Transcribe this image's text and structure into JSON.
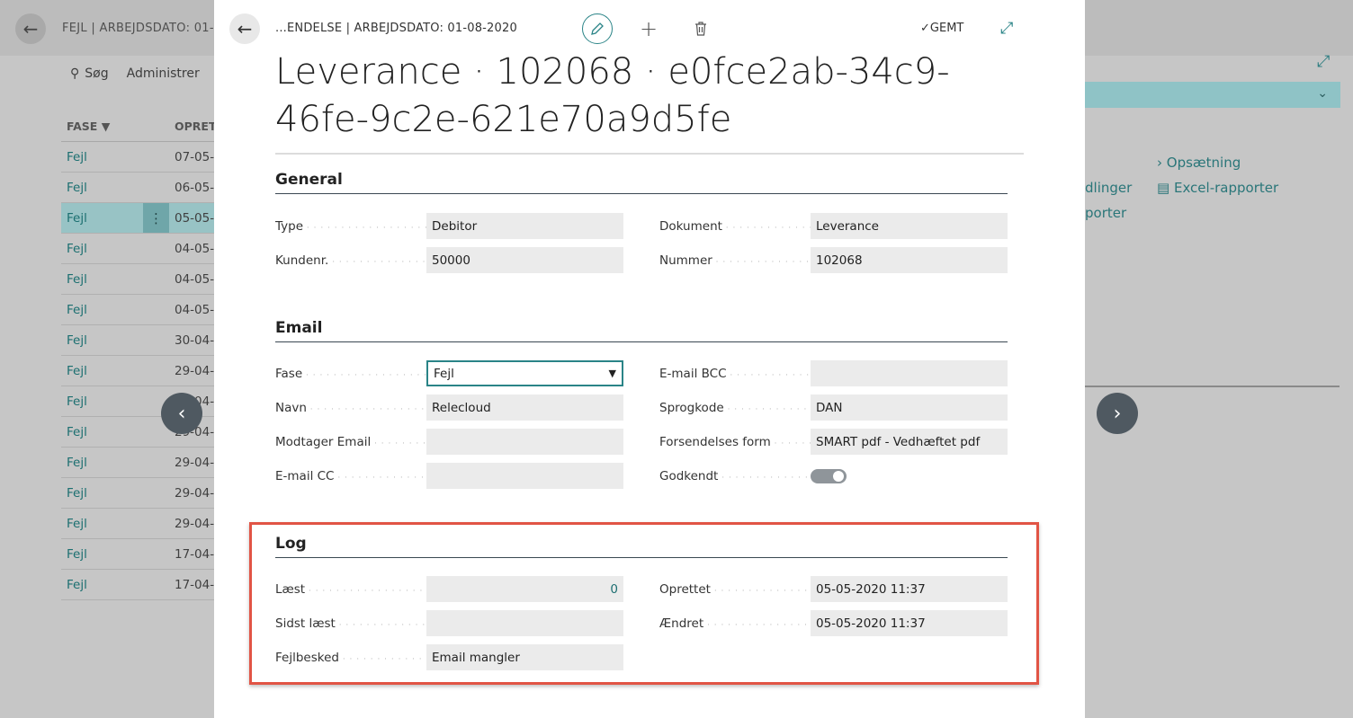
{
  "background": {
    "title": "FEJL | ARBEJDSDATO: 01-0",
    "actions": {
      "search": "Søg",
      "manage": "Administrer"
    },
    "columns": {
      "phase": "FASE",
      "created": "OPRET"
    },
    "rows": [
      {
        "phase": "Fejl",
        "date": "07-05-"
      },
      {
        "phase": "Fejl",
        "date": "06-05-"
      },
      {
        "phase": "Fejl",
        "date": "05-05-"
      },
      {
        "phase": "Fejl",
        "date": "04-05-"
      },
      {
        "phase": "Fejl",
        "date": "04-05-"
      },
      {
        "phase": "Fejl",
        "date": "04-05-"
      },
      {
        "phase": "Fejl",
        "date": "30-04-"
      },
      {
        "phase": "Fejl",
        "date": "29-04-"
      },
      {
        "phase": "Fejl",
        "date": "29-04-"
      },
      {
        "phase": "Fejl",
        "date": "29-04-"
      },
      {
        "phase": "Fejl",
        "date": "29-04-"
      },
      {
        "phase": "Fejl",
        "date": "29-04-"
      },
      {
        "phase": "Fejl",
        "date": "29-04-"
      },
      {
        "phase": "Fejl",
        "date": "17-04-"
      },
      {
        "phase": "Fejl",
        "date": "17-04-"
      }
    ],
    "right_links": {
      "setup": "Opsætning",
      "excel": "Excel-rapporter",
      "partial1": "dlinger",
      "partial2": "porter"
    }
  },
  "dialog": {
    "breadcrumb": "...ENDELSE | ARBEJDSDATO: 01-08-2020",
    "saved_label": "GEMT",
    "title": "Leverance · 102068 · e0fce2ab-34c9-46fe-9c2e-621e70a9d5fe",
    "general": {
      "heading": "General",
      "type_label": "Type",
      "type_value": "Debitor",
      "customer_label": "Kundenr.",
      "customer_value": "50000",
      "document_label": "Dokument",
      "document_value": "Leverance",
      "number_label": "Nummer",
      "number_value": "102068"
    },
    "email": {
      "heading": "Email",
      "phase_label": "Fase",
      "phase_value": "Fejl",
      "name_label": "Navn",
      "name_value": "Relecloud",
      "recipient_label": "Modtager Email",
      "recipient_value": "",
      "cc_label": "E-mail CC",
      "cc_value": "",
      "bcc_label": "E-mail BCC",
      "bcc_value": "",
      "lang_label": "Sprogkode",
      "lang_value": "DAN",
      "form_label": "Forsendelses form",
      "form_value": "SMART pdf - Vedhæftet pdf",
      "approved_label": "Godkendt",
      "approved": true
    },
    "log": {
      "heading": "Log",
      "read_label": "Læst",
      "read_value": "0",
      "last_read_label": "Sidst læst",
      "last_read_value": "",
      "error_label": "Fejlbesked",
      "error_value": "Email mangler",
      "created_label": "Oprettet",
      "created_value": "05-05-2020 11:37",
      "changed_label": "Ændret",
      "changed_value": "05-05-2020 11:37"
    }
  },
  "colors": {
    "accent": "#2a8487",
    "highlight": "#e15445"
  }
}
